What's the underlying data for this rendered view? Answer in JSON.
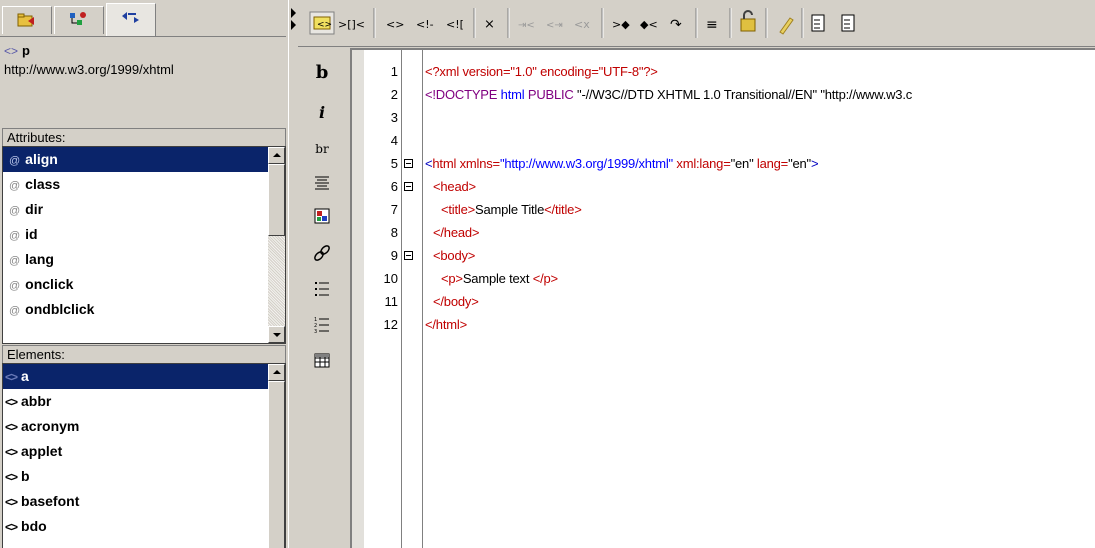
{
  "element_info": {
    "tag_glyph": "<>",
    "name": "p",
    "namespace": "http://www.w3.org/1999/xhtml"
  },
  "attributes": {
    "header": "Attributes:",
    "prefix": "@",
    "items": [
      "align",
      "class",
      "dir",
      "id",
      "lang",
      "onclick",
      "ondblclick"
    ]
  },
  "elements": {
    "header": "Elements:",
    "prefix": "<>",
    "items": [
      "a",
      "abbr",
      "acronym",
      "applet",
      "b",
      "basefont",
      "bdo"
    ]
  },
  "toolbar": {
    "buttons": [
      {
        "id": "tag-view",
        "glyph": "<>"
      },
      {
        "id": "split-view",
        "glyph": ">[]<"
      },
      {
        "id": "insert-tag",
        "glyph": "<>"
      },
      {
        "id": "insert-comment",
        "glyph": "<!-"
      },
      {
        "id": "insert-cdata",
        "glyph": "<!["
      },
      {
        "id": "validate",
        "glyph": "⨉"
      },
      {
        "id": "step-in",
        "glyph": "⇥"
      },
      {
        "id": "step-over",
        "glyph": "⇄"
      },
      {
        "id": "step-out",
        "glyph": "<"
      },
      {
        "id": "collapse",
        "glyph": "⊳⊲"
      },
      {
        "id": "expand",
        "glyph": "⊲⊳"
      },
      {
        "id": "redo",
        "glyph": "↷"
      },
      {
        "id": "format",
        "glyph": "≡"
      },
      {
        "id": "unlock",
        "glyph": "🔓"
      },
      {
        "id": "clean",
        "glyph": "✎"
      },
      {
        "id": "indent",
        "glyph": "⇲"
      },
      {
        "id": "outdent",
        "glyph": "⇱"
      }
    ]
  },
  "vertical_toolbar": {
    "bold": "b",
    "italic": "i",
    "break": "br"
  },
  "editor": {
    "lines": [
      {
        "n": "1",
        "fold": false
      },
      {
        "n": "2",
        "fold": false
      },
      {
        "n": "3",
        "fold": false
      },
      {
        "n": "4",
        "fold": false
      },
      {
        "n": "5",
        "fold": true
      },
      {
        "n": "6",
        "fold": true
      },
      {
        "n": "7",
        "fold": false
      },
      {
        "n": "8",
        "fold": false
      },
      {
        "n": "9",
        "fold": true
      },
      {
        "n": "10",
        "fold": false
      },
      {
        "n": "11",
        "fold": false
      },
      {
        "n": "12",
        "fold": false
      }
    ],
    "code": {
      "l1": "<?xml version=\"1.0\" encoding=\"UTF-8\"?>",
      "l2_a": "<!DOCTYPE",
      "l2_b": "html",
      "l2_c": "PUBLIC",
      "l2_d": "\"-//W3C//DTD XHTML 1.0 Transitional//EN\"",
      "l2_e": "\"http://www.w3.c",
      "l5_open": "<",
      "l5_tag": "html",
      "l5_attr1": "xmlns=",
      "l5_val1": "\"http://www.w3.org/1999/xhtml\"",
      "l5_attr2": "xml:lang=",
      "l5_val2": "\"en\"",
      "l5_attr3": "lang=",
      "l5_val3": "\"en\"",
      "l5_close": ">",
      "l6": "<head>",
      "l7_a": "<title>",
      "l7_b": "Sample Title",
      "l7_c": "</title>",
      "l8": "</head>",
      "l9": "<body>",
      "l10_a": "<p>",
      "l10_b": "Sample text ",
      "l10_c": "</p>",
      "l11": "</body>",
      "l12": "</html>"
    }
  }
}
